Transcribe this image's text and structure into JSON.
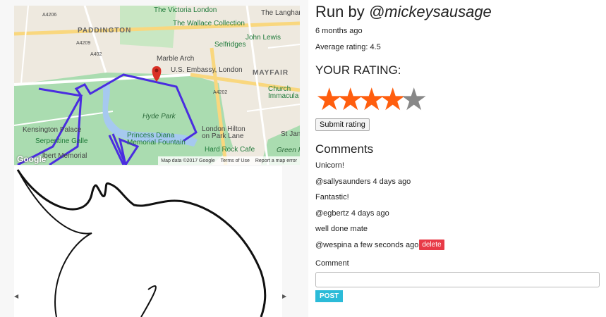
{
  "run": {
    "title_prefix": "Run by ",
    "username": "@mickeysausage",
    "age": "6 months ago",
    "average": "Average rating: 4.5"
  },
  "rating": {
    "heading": "YOUR RATING:",
    "stars_total": 5,
    "stars_selected": 4,
    "star_glyph": "★",
    "submit_label": "Submit rating"
  },
  "comments": {
    "heading": "Comments",
    "items": [
      {
        "text": "Unicorn!",
        "meta": "@sallysaunders 4 days ago"
      },
      {
        "text": "Fantastic!",
        "meta": "@egbertz 4 days ago"
      },
      {
        "text": "well done mate",
        "meta": "@wespina a few seconds ago",
        "delete_label": "delete"
      }
    ],
    "form_label": "Comment",
    "input_value": "",
    "post_label": "POST"
  },
  "map": {
    "labels": {
      "paddington": "PADDINGTON",
      "victoria_london": "The Victoria London",
      "wallace": "The Wallace Collection",
      "langham": "The Langham",
      "john_lewis": "John Lewis",
      "selfridges": "Selfridges",
      "marble_arch": "Marble Arch",
      "us_embassy": "U.S. Embassy, London",
      "mayfair": "MAYFAIR",
      "church": "Church",
      "immacula": "Immacula",
      "hyde_park": "Hyde Park",
      "kensington_palace": "Kensington Palace",
      "serpentine": "Serpentine Galle",
      "albert": "lbert Memorial",
      "diana1": "Princess Diana",
      "diana2": "Memorial Fountain",
      "hilton1": "London Hilton",
      "hilton2": "on Park Lane",
      "hard_rock": "Hard Rock Cafe",
      "green_park": "Green P",
      "st_jam": "St Jan",
      "google": "Google",
      "map_data": "Map data ©2017 Google",
      "terms": "Terms of Use",
      "report": "Report a map error",
      "road_a4206": "A4206",
      "road_a4209": "A4209",
      "road_a402": "A402",
      "road_a4202": "A4202"
    },
    "route_color": "#4a2de0",
    "pin_color": "#d93025"
  },
  "colors": {
    "star_on": "#ff5e0e",
    "star_off": "#888888",
    "delete_bg": "#e83a47",
    "post_bg": "#2bbbd8"
  }
}
